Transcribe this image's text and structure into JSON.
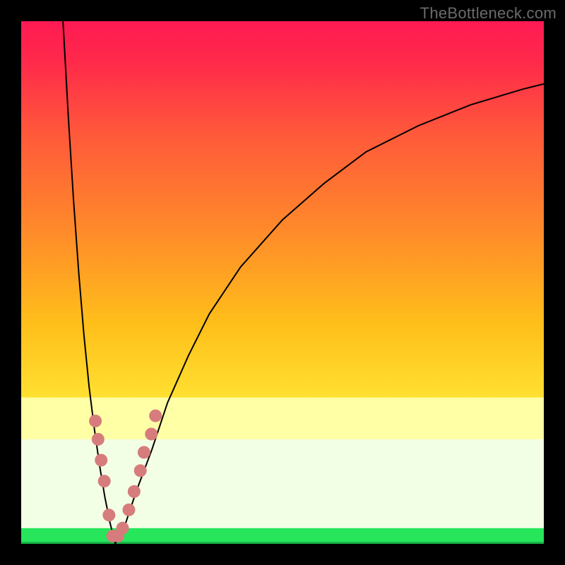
{
  "watermark": "TheBottleneck.com",
  "chart_data": {
    "type": "line",
    "title": "",
    "xlabel": "",
    "ylabel": "",
    "xlim": [
      0,
      100
    ],
    "ylim": [
      0,
      100
    ],
    "optimum_x": 18,
    "background": {
      "top_color": "#ff1a4d",
      "mid_color": "#ffcf00",
      "low_band_color": "#ffffa6",
      "bottom_color": "#27e65c"
    },
    "series": [
      {
        "name": "left-curve",
        "x": [
          8,
          9,
          10,
          11,
          12,
          13,
          14,
          15,
          16,
          17,
          18
        ],
        "y": [
          100,
          82,
          66,
          52,
          40,
          30,
          22,
          15,
          9,
          4,
          0
        ]
      },
      {
        "name": "right-curve",
        "x": [
          18,
          20,
          22,
          25,
          28,
          32,
          36,
          42,
          50,
          58,
          66,
          76,
          86,
          96,
          100
        ],
        "y": [
          0,
          4,
          10,
          18,
          27,
          36,
          44,
          53,
          62,
          69,
          75,
          80,
          84,
          87,
          88
        ]
      }
    ],
    "markers": {
      "color": "#d67c7c",
      "radius_px": 9,
      "points": [
        {
          "x": 14.2,
          "y": 23.5
        },
        {
          "x": 14.7,
          "y": 20.0
        },
        {
          "x": 15.3,
          "y": 16.0
        },
        {
          "x": 15.9,
          "y": 12.0
        },
        {
          "x": 16.8,
          "y": 5.5
        },
        {
          "x": 17.5,
          "y": 1.5
        },
        {
          "x": 18.5,
          "y": 1.5
        },
        {
          "x": 19.4,
          "y": 3.0
        },
        {
          "x": 20.6,
          "y": 6.5
        },
        {
          "x": 21.6,
          "y": 10.0
        },
        {
          "x": 22.8,
          "y": 14.0
        },
        {
          "x": 23.5,
          "y": 17.5
        },
        {
          "x": 24.9,
          "y": 21.0
        },
        {
          "x": 25.7,
          "y": 24.5
        }
      ]
    }
  }
}
